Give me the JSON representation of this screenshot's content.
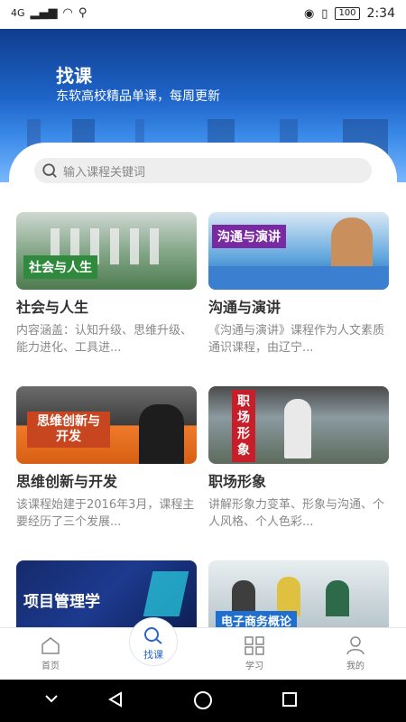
{
  "status": {
    "network": "4G",
    "battery": "100",
    "time": "2:34"
  },
  "header": {
    "title": "找课",
    "subtitle": "东软高校精品单课，每周更新"
  },
  "search": {
    "placeholder": "输入课程关键词"
  },
  "courses": [
    {
      "title": "社会与人生",
      "tag": "社会与人生",
      "desc": "内容涵盖：认知升级、思维升级、能力进化、工具进..."
    },
    {
      "title": "沟通与演讲",
      "tag": "沟通与演讲",
      "desc": "《沟通与演讲》课程作为人文素质通识课程，由辽宁..."
    },
    {
      "title": "思维创新与开发",
      "tag": "思维创新与开发",
      "desc": "该课程始建于2016年3月，课程主要经历了三个发展..."
    },
    {
      "title": "职场形象",
      "tag": "职场形象",
      "desc": "讲解形象力变革、形象与沟通、个人风格、个人色彩..."
    },
    {
      "title": "",
      "tag": "项目管理学",
      "desc": ""
    },
    {
      "title": "",
      "tag": "电子商务概论",
      "desc": ""
    }
  ],
  "nav": {
    "home": "首页",
    "find": "找课",
    "study": "学习",
    "mine": "我的"
  },
  "colors": {
    "accent": "#2a64c8",
    "hero_top": "#0f3d8e"
  }
}
